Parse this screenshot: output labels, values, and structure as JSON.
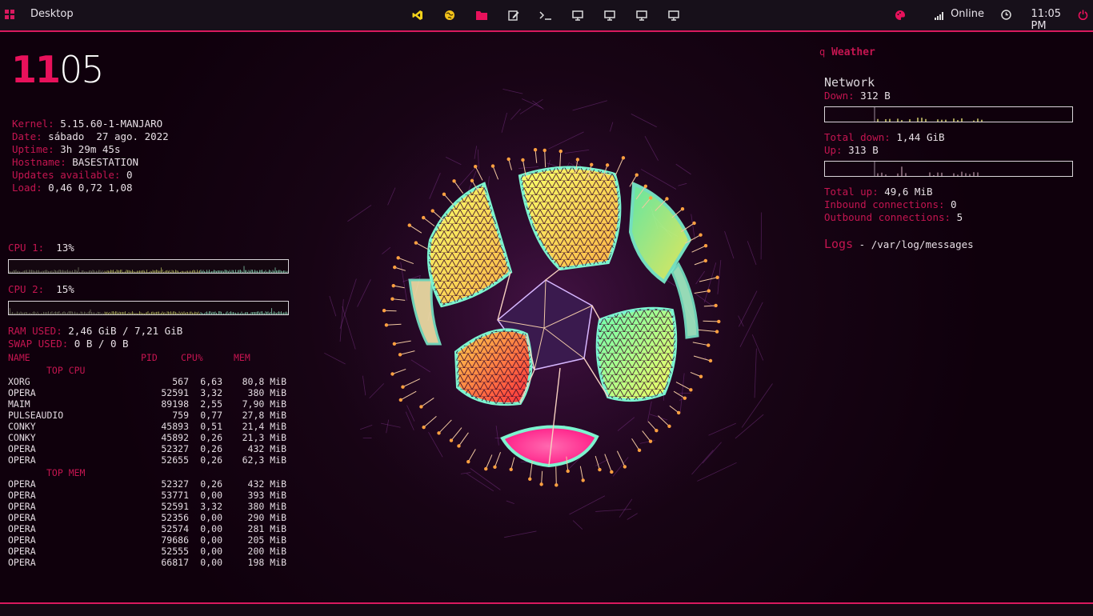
{
  "topbar": {
    "workspace_label": "Desktop",
    "launchers": [
      {
        "name": "vscode-icon",
        "color": "#f2d21b"
      },
      {
        "name": "globe-icon",
        "color": "#f2c21b"
      },
      {
        "name": "folder-icon",
        "color": "#e8115b"
      },
      {
        "name": "edit-icon",
        "color": "#dcdcdc"
      },
      {
        "name": "terminal-icon",
        "color": "#dcdcdc"
      },
      {
        "name": "monitor-icon",
        "color": "#dcdcdc"
      },
      {
        "name": "monitor-icon",
        "color": "#dcdcdc"
      },
      {
        "name": "monitor-icon",
        "color": "#dcdcdc"
      },
      {
        "name": "monitor-icon",
        "color": "#dcdcdc"
      }
    ],
    "network_status": "Online",
    "clock": "11:05 PM"
  },
  "left": {
    "clock_hours": "11",
    "clock_minutes": "05",
    "system": {
      "kernel_label": "Kernel:",
      "kernel": "5.15.60-1-MANJARO",
      "date_label": "Date:",
      "date": "sábado  27 ago. 2022",
      "uptime_label": "Uptime:",
      "uptime": "3h 29m 45s",
      "hostname_label": "Hostname:",
      "hostname": "BASESTATION",
      "updates_label": "Updates available:",
      "updates": "0",
      "load_label": "Load:",
      "load": "0,46 0,72 1,08"
    },
    "cpu1_label": "CPU 1:",
    "cpu1_value": "13%",
    "cpu2_label": "CPU 2:",
    "cpu2_value": "15%",
    "ram_label": "RAM USED:",
    "ram_value": "2,46 GiB / 7,21 GiB",
    "swap_label": "SWAP USED:",
    "swap_value": "0 B / 0 B",
    "proc_headers": {
      "name": "NAME",
      "pid": "PID",
      "cpu": "CPU%",
      "mem": "MEM"
    },
    "top_cpu_title": "TOP CPU",
    "top_cpu": [
      {
        "name": "XORG",
        "pid": "567",
        "cpu": "6,63",
        "mem": "80,8 MiB"
      },
      {
        "name": "OPERA",
        "pid": "52591",
        "cpu": "3,32",
        "mem": "380 MiB"
      },
      {
        "name": "MAIM",
        "pid": "89198",
        "cpu": "2,55",
        "mem": "7,90 MiB"
      },
      {
        "name": "PULSEAUDIO",
        "pid": "759",
        "cpu": "0,77",
        "mem": "27,8 MiB"
      },
      {
        "name": "CONKY",
        "pid": "45893",
        "cpu": "0,51",
        "mem": "21,4 MiB"
      },
      {
        "name": "CONKY",
        "pid": "45892",
        "cpu": "0,26",
        "mem": "21,3 MiB"
      },
      {
        "name": "OPERA",
        "pid": "52327",
        "cpu": "0,26",
        "mem": "432 MiB"
      },
      {
        "name": "OPERA",
        "pid": "52655",
        "cpu": "0,26",
        "mem": "62,3 MiB"
      }
    ],
    "top_mem_title": "TOP MEM",
    "top_mem": [
      {
        "name": "OPERA",
        "pid": "52327",
        "cpu": "0,26",
        "mem": "432 MiB"
      },
      {
        "name": "OPERA",
        "pid": "53771",
        "cpu": "0,00",
        "mem": "393 MiB"
      },
      {
        "name": "OPERA",
        "pid": "52591",
        "cpu": "3,32",
        "mem": "380 MiB"
      },
      {
        "name": "OPERA",
        "pid": "52356",
        "cpu": "0,00",
        "mem": "290 MiB"
      },
      {
        "name": "OPERA",
        "pid": "52574",
        "cpu": "0,00",
        "mem": "281 MiB"
      },
      {
        "name": "OPERA",
        "pid": "79686",
        "cpu": "0,00",
        "mem": "205 MiB"
      },
      {
        "name": "OPERA",
        "pid": "52555",
        "cpu": "0,00",
        "mem": "200 MiB"
      },
      {
        "name": "OPERA",
        "pid": "66817",
        "cpu": "0,00",
        "mem": "198 MiB"
      }
    ]
  },
  "right": {
    "weather_icon": "q",
    "weather_label": "Weather",
    "network_title": "Network",
    "down_label": "Down:",
    "down_value": "312 B",
    "total_down_label": "Total down:",
    "total_down_value": "1,44 GiB",
    "up_label": "Up:",
    "up_value": "313 B",
    "total_up_label": "Total up:",
    "total_up_value": "49,6 MiB",
    "inbound_label": "Inbound connections:",
    "inbound_value": "0",
    "outbound_label": "Outbound connections:",
    "outbound_value": "5",
    "logs_label": "Logs",
    "logs_path": "- /var/log/messages"
  },
  "colors": {
    "accent": "#d8195e",
    "label": "#c41550",
    "background": "#12000f"
  }
}
